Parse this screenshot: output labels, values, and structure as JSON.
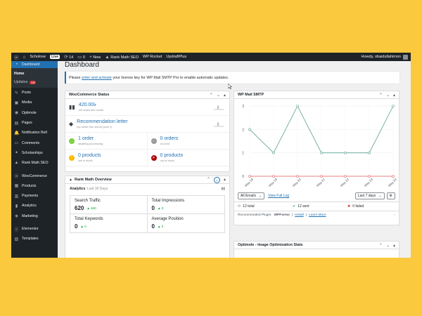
{
  "adminbar": {
    "site_name": "Scholove",
    "live_label": "Live",
    "updates_count": "14",
    "comments_count": "0",
    "new_label": "New",
    "rankmath_label": "Rank Math SEO",
    "wprocket_label": "WP Rocket",
    "updraft_label": "UpdraftPlus",
    "howdy": "Howdy, obaidullahimon"
  },
  "sidebar": {
    "dashboard": "Dashboard",
    "home": "Home",
    "updates": "Updates",
    "updates_badge": "14",
    "items": [
      "Posts",
      "Media",
      "Optimole",
      "Pages",
      "Notification Bell",
      "Comments",
      "Scholarships",
      "Rank Math SEO",
      "WooCommerce",
      "Products",
      "Payments",
      "Analytics",
      "Marketing",
      "Elementor",
      "Templates"
    ]
  },
  "page": {
    "title": "Dashboard",
    "notice_pre": "Please",
    "notice_link": "enter and activate",
    "notice_post": "your license key for WP Mail SMTP Pro to enable automatic updates."
  },
  "woo": {
    "title": "WooCommerce Status",
    "net_sales_value": "420.00৳",
    "net_sales_label": "net sales this month",
    "top_seller_value": "Recommendation letter",
    "top_seller_label": "top seller this month (sold 1)",
    "awaiting_value": "1 order",
    "awaiting_label": "awaiting processing",
    "onhold_value": "0 orders",
    "onhold_label": "on-hold",
    "lowstock_value": "0 products",
    "lowstock_label": "low in stock",
    "outstock_value": "0 products",
    "outstock_label": "out of stock"
  },
  "rankmath": {
    "title": "Rank Math Overview",
    "analytics_label": "Analytics",
    "period": "Last 30 Days",
    "search_traffic_label": "Search Traffic",
    "search_traffic_value": "620",
    "search_traffic_change": "620",
    "impressions_label": "Total Impressions",
    "impressions_value": "0",
    "impressions_change": "0",
    "keywords_label": "Total Keywords",
    "keywords_value": "0",
    "keywords_change": "0",
    "position_label": "Average Position",
    "position_value": "0",
    "position_change": "0"
  },
  "smtp": {
    "title": "WP Mail SMTP",
    "filter_value": "All Emails",
    "full_log_link": "View Full Log",
    "range_value": "Last 7 days",
    "total": "12 total",
    "sent": "12 sent",
    "failed": "0 failed",
    "recommended_pre": "Recommended Plugin:",
    "recommended_plugin": "WPForms",
    "install_link": "Install",
    "learn_link": "Learn More"
  },
  "optimole": {
    "title": "Optimole - Image Optimization Stats"
  },
  "chart_data": {
    "type": "line",
    "categories": [
      "May 18",
      "May 19",
      "May 20",
      "May 21",
      "May 22",
      "May 23",
      "May 24"
    ],
    "ylim": [
      0,
      3
    ],
    "yticks": [
      "0",
      "1",
      "2",
      "3"
    ],
    "series": [
      {
        "values": [
          2,
          1,
          3,
          1,
          1,
          1,
          3
        ],
        "color": "#5a9e8f"
      },
      {
        "values": [
          0,
          0,
          0,
          0,
          0,
          0,
          0
        ],
        "color": "#e05a5a"
      }
    ]
  }
}
